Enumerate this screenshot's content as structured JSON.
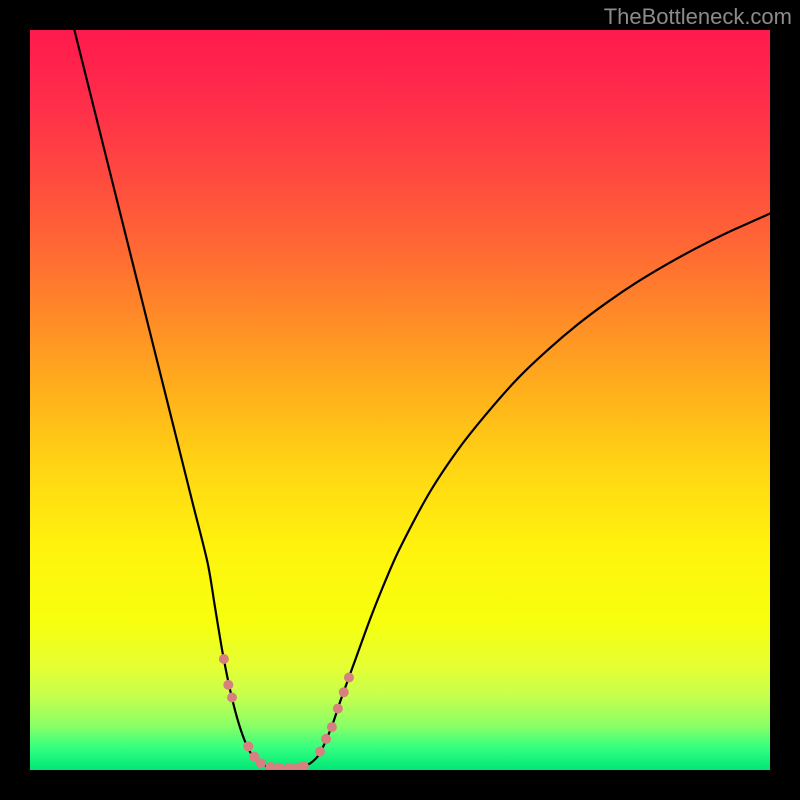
{
  "watermark": "TheBottleneck.com",
  "chart_data": {
    "type": "line",
    "title": "",
    "xlabel": "",
    "ylabel": "",
    "xlim": [
      0,
      100
    ],
    "ylim": [
      0,
      100
    ],
    "gradient_stops": [
      {
        "offset": 0.0,
        "color": "#ff1a4d"
      },
      {
        "offset": 0.1,
        "color": "#ff2e4a"
      },
      {
        "offset": 0.2,
        "color": "#ff4a3f"
      },
      {
        "offset": 0.3,
        "color": "#ff6a33"
      },
      {
        "offset": 0.4,
        "color": "#ff8f26"
      },
      {
        "offset": 0.5,
        "color": "#ffb41a"
      },
      {
        "offset": 0.6,
        "color": "#ffd813"
      },
      {
        "offset": 0.7,
        "color": "#fff30d"
      },
      {
        "offset": 0.8,
        "color": "#f7ff0d"
      },
      {
        "offset": 0.86,
        "color": "#e5ff33"
      },
      {
        "offset": 0.9,
        "color": "#c6ff4d"
      },
      {
        "offset": 0.94,
        "color": "#8aff66"
      },
      {
        "offset": 0.97,
        "color": "#33ff80"
      },
      {
        "offset": 1.0,
        "color": "#00e676"
      }
    ],
    "series": [
      {
        "name": "bottleneck-curve",
        "color": "#000000",
        "width": 2.2,
        "points": [
          {
            "x": 6.0,
            "y": 100.0
          },
          {
            "x": 8.0,
            "y": 92.0
          },
          {
            "x": 10.0,
            "y": 84.0
          },
          {
            "x": 12.0,
            "y": 76.0
          },
          {
            "x": 14.0,
            "y": 68.0
          },
          {
            "x": 16.0,
            "y": 60.0
          },
          {
            "x": 18.0,
            "y": 52.0
          },
          {
            "x": 20.0,
            "y": 44.0
          },
          {
            "x": 22.0,
            "y": 36.0
          },
          {
            "x": 24.0,
            "y": 28.0
          },
          {
            "x": 25.0,
            "y": 22.0
          },
          {
            "x": 26.0,
            "y": 16.0
          },
          {
            "x": 27.0,
            "y": 11.0
          },
          {
            "x": 28.0,
            "y": 7.0
          },
          {
            "x": 29.0,
            "y": 4.0
          },
          {
            "x": 30.0,
            "y": 2.0
          },
          {
            "x": 31.0,
            "y": 1.0
          },
          {
            "x": 32.0,
            "y": 0.5
          },
          {
            "x": 33.0,
            "y": 0.3
          },
          {
            "x": 34.0,
            "y": 0.3
          },
          {
            "x": 35.0,
            "y": 0.3
          },
          {
            "x": 36.0,
            "y": 0.3
          },
          {
            "x": 37.0,
            "y": 0.5
          },
          {
            "x": 38.0,
            "y": 1.0
          },
          {
            "x": 39.0,
            "y": 2.0
          },
          {
            "x": 40.0,
            "y": 4.0
          },
          {
            "x": 41.0,
            "y": 6.5
          },
          {
            "x": 42.0,
            "y": 9.5
          },
          {
            "x": 44.0,
            "y": 15.0
          },
          {
            "x": 46.0,
            "y": 20.5
          },
          {
            "x": 48.0,
            "y": 25.5
          },
          {
            "x": 50.0,
            "y": 30.0
          },
          {
            "x": 54.0,
            "y": 37.5
          },
          {
            "x": 58.0,
            "y": 43.5
          },
          {
            "x": 62.0,
            "y": 48.5
          },
          {
            "x": 66.0,
            "y": 53.0
          },
          {
            "x": 70.0,
            "y": 56.8
          },
          {
            "x": 74.0,
            "y": 60.2
          },
          {
            "x": 78.0,
            "y": 63.2
          },
          {
            "x": 82.0,
            "y": 65.9
          },
          {
            "x": 86.0,
            "y": 68.3
          },
          {
            "x": 90.0,
            "y": 70.5
          },
          {
            "x": 94.0,
            "y": 72.5
          },
          {
            "x": 98.0,
            "y": 74.3
          },
          {
            "x": 100.0,
            "y": 75.2
          }
        ]
      }
    ],
    "highlight_points": {
      "color": "#d6817f",
      "radius": 5.0,
      "points": [
        {
          "x": 26.2,
          "y": 15.0
        },
        {
          "x": 26.8,
          "y": 11.5
        },
        {
          "x": 27.3,
          "y": 9.8
        },
        {
          "x": 29.5,
          "y": 3.2
        },
        {
          "x": 30.3,
          "y": 1.8
        },
        {
          "x": 31.2,
          "y": 0.9
        },
        {
          "x": 32.5,
          "y": 0.4
        },
        {
          "x": 33.7,
          "y": 0.3
        },
        {
          "x": 35.0,
          "y": 0.3
        },
        {
          "x": 36.2,
          "y": 0.3
        },
        {
          "x": 37.0,
          "y": 0.5
        },
        {
          "x": 39.2,
          "y": 2.5
        },
        {
          "x": 40.0,
          "y": 4.2
        },
        {
          "x": 40.8,
          "y": 5.8
        },
        {
          "x": 41.6,
          "y": 8.3
        },
        {
          "x": 42.4,
          "y": 10.5
        },
        {
          "x": 43.1,
          "y": 12.5
        }
      ]
    }
  }
}
